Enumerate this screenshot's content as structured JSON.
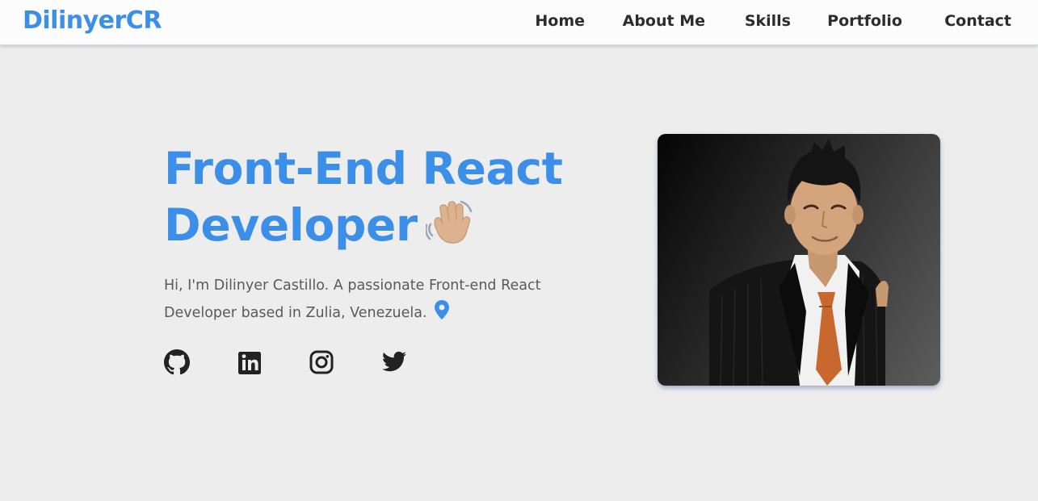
{
  "brand": {
    "name": "DilinyerCR"
  },
  "nav": {
    "home": "Home",
    "about": "About Me",
    "skills": "Skills",
    "portfolio": "Portfolio",
    "contact": "Contact"
  },
  "hero": {
    "title_line1": "Front-End React",
    "title_line2": "Developer",
    "wave_icon": "waving-hand",
    "description": "Hi, I'm Dilinyer Castillo. A passionate Front-end React Developer based in Zulia, Venezuela.",
    "location_icon": "location-pin"
  },
  "social": [
    "github-icon",
    "linkedin-icon",
    "instagram-icon",
    "twitter-icon"
  ],
  "colors": {
    "accent": "#3b8fe8",
    "background": "#ededed",
    "navbar": "#fcfcfc",
    "text": "#2c2c2c",
    "muted_text": "#5a5a5a"
  }
}
